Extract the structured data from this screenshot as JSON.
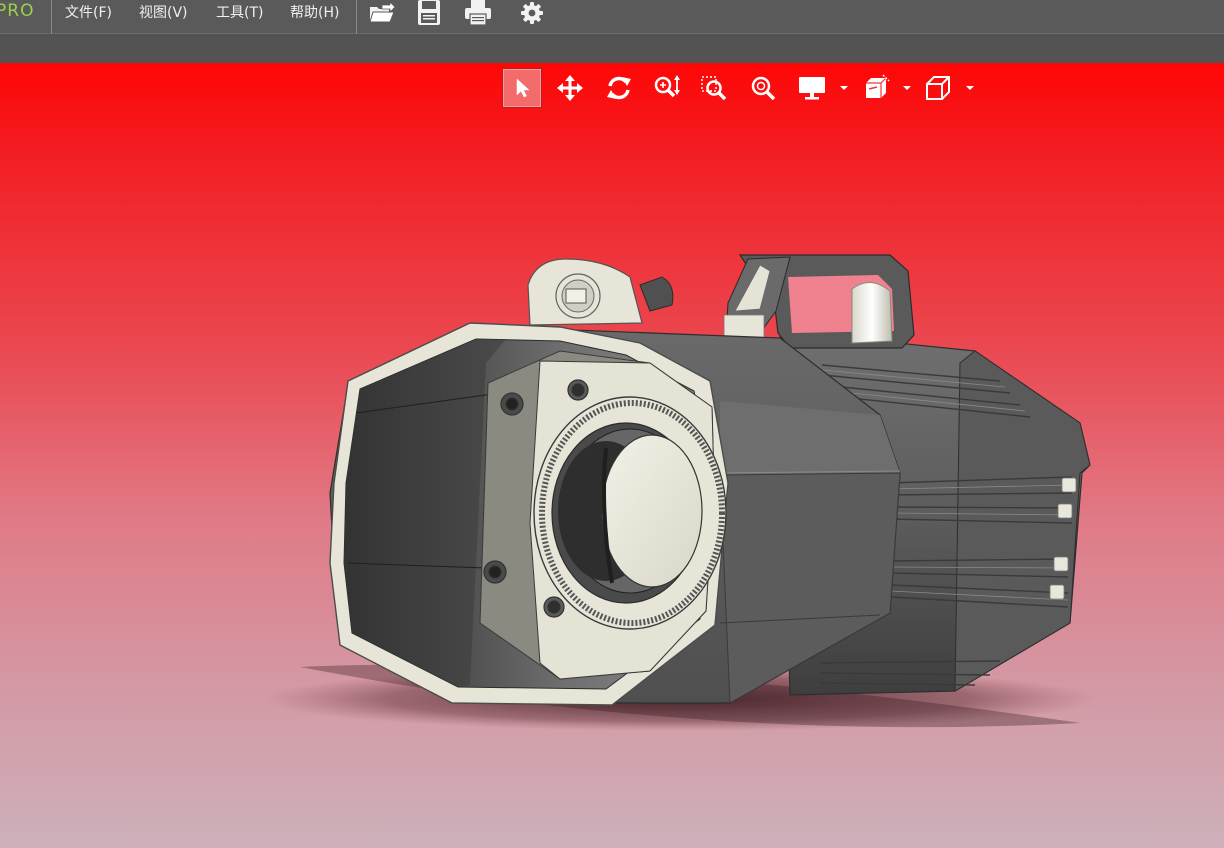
{
  "app": {
    "logo_text": "PRO"
  },
  "menu": {
    "items": [
      {
        "label": "文件(F)"
      },
      {
        "label": "视图(V)"
      },
      {
        "label": "工具(T)"
      },
      {
        "label": "帮助(H)"
      }
    ]
  },
  "toolbar": {
    "icons": [
      "open-folder-icon",
      "save-icon",
      "print-icon",
      "settings-gear-icon"
    ]
  },
  "view_toolbar": {
    "tools": [
      {
        "icon": "select-arrow-icon",
        "active": true
      },
      {
        "icon": "pan-move-icon",
        "active": false
      },
      {
        "icon": "rotate-icon",
        "active": false
      },
      {
        "icon": "zoom-in-out-icon",
        "active": false
      },
      {
        "icon": "zoom-window-icon",
        "active": false
      },
      {
        "icon": "zoom-fit-icon",
        "active": false
      },
      {
        "icon": "display-mode-icon",
        "has_dropdown": true
      },
      {
        "icon": "section-view-icon",
        "has_dropdown": true
      },
      {
        "icon": "standard-views-cube-icon",
        "has_dropdown": true
      }
    ]
  },
  "colors": {
    "menubar_bg": "#5a5a5a",
    "strip_bg": "#535353",
    "logo": "#9cd04a",
    "viewport_top": "#ff0606",
    "viewport_bottom": "#cdb0ba",
    "active_tool": "#f36b6b",
    "model_dark": "#5e5e5e",
    "model_light": "#e6e5d8"
  }
}
